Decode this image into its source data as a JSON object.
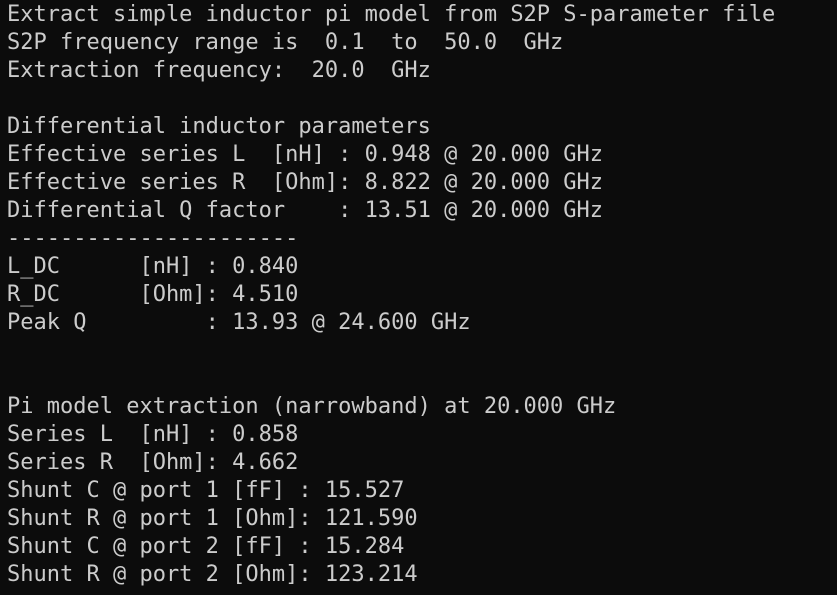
{
  "terminal": {
    "lines": [
      "Extract simple inductor pi model from S2P S-parameter file",
      "S2P frequency range is  0.1  to  50.0  GHz",
      "Extraction frequency:  20.0  GHz",
      "",
      "Differential inductor parameters",
      "Effective series L  [nH] : 0.948 @ 20.000 GHz",
      "Effective series R  [Ohm]: 8.822 @ 20.000 GHz",
      "Differential Q factor    : 13.51 @ 20.000 GHz",
      "----------------------",
      "L_DC      [nH] : 0.840",
      "R_DC      [Ohm]: 4.510",
      "Peak Q         : 13.93 @ 24.600 GHz",
      "",
      "",
      "Pi model extraction (narrowband) at 20.000 GHz",
      "Series L  [nH] : 0.858",
      "Series R  [Ohm]: 4.662",
      "Shunt C @ port 1 [fF] : 15.527",
      "Shunt R @ port 1 [Ohm]: 121.590",
      "Shunt C @ port 2 [fF] : 15.284",
      "Shunt R @ port 2 [Ohm]: 123.214"
    ]
  }
}
